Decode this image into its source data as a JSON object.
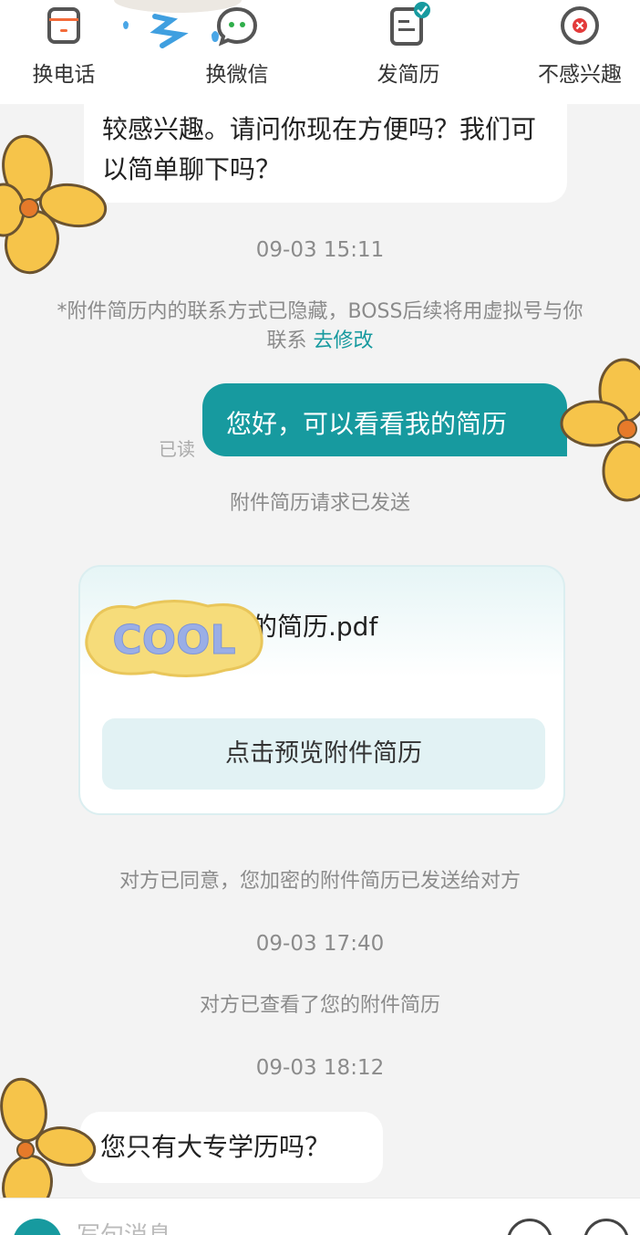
{
  "topbar": {
    "actions": [
      {
        "label": "换电话",
        "icon": "phone-icon"
      },
      {
        "label": "换微信",
        "icon": "wechat-icon"
      },
      {
        "label": "发简历",
        "icon": "resume-icon"
      },
      {
        "label": "不感兴趣",
        "icon": "close-circle-icon"
      }
    ]
  },
  "messages": {
    "first_received": "较感兴趣。请问你现在方便吗？我们可以简单聊下吗？",
    "time1": "09-03 15:11",
    "notice_main": "*附件简历内的联系方式已隐藏，BOSS后续将用虚拟号与你联系",
    "notice_link": "去修改",
    "sent_text": "您好，可以看看我的简历",
    "read_status": "已读",
    "request_sent": "附件简历请求已发送",
    "resume_file": "的简历.pdf",
    "resume_preview_button": "点击预览附件简历",
    "agree_notice": "对方已同意，您加密的附件简历已发送给对方",
    "time2": "09-03 17:40",
    "viewed_notice": "对方已查看了您的附件简历",
    "time3": "09-03 18:12",
    "last_received": "您只有大专学历吗？"
  },
  "stickers": {
    "cool_text": "COOL"
  },
  "input": {
    "placeholder": "写句消息"
  },
  "colors": {
    "accent": "#179a9f",
    "bubble_received": "#ffffff",
    "background": "#f3f3f3"
  }
}
